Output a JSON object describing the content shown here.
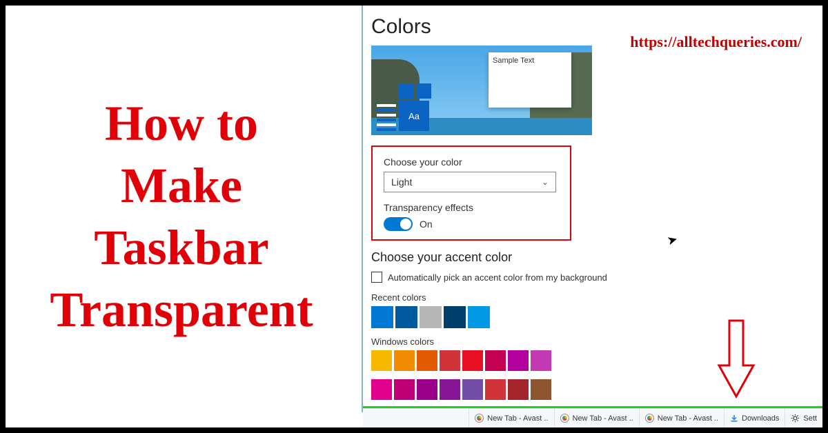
{
  "headline": "How to\nMake\nTaskbar\nTransparent",
  "watermark_url": "https://alltechqueries.com/",
  "settings": {
    "page_title": "Colors",
    "preview_sample_text": "Sample Text",
    "preview_tile_label": "Aa",
    "choose_color_label": "Choose your color",
    "choose_color_value": "Light",
    "transparency_label": "Transparency effects",
    "transparency_state": "On",
    "accent_title": "Choose your accent color",
    "auto_accent_label": "Automatically pick an accent color from my background",
    "recent_label": "Recent colors",
    "recent_colors": [
      "#0078d4",
      "#005a9e",
      "#b6b6b6",
      "#003e6b",
      "#0099e5"
    ],
    "windows_label": "Windows colors",
    "windows_colors_row1": [
      "#f6b900",
      "#f28c00",
      "#e35b00",
      "#d13438",
      "#e81123",
      "#c30052",
      "#b4009e",
      "#c239b3"
    ],
    "windows_colors_row2": [
      "#e3008c",
      "#bf0077",
      "#9a0089",
      "#881798",
      "#744da9",
      "#d13438",
      "#a4262c",
      "#8e562e"
    ]
  },
  "taskbar": {
    "items": [
      {
        "icon": "browser",
        "label": "New Tab - Avast .."
      },
      {
        "icon": "browser",
        "label": "New Tab - Avast .."
      },
      {
        "icon": "browser",
        "label": "New Tab - Avast .."
      },
      {
        "icon": "download",
        "label": "Downloads"
      },
      {
        "icon": "gear",
        "label": "Sett"
      }
    ]
  }
}
